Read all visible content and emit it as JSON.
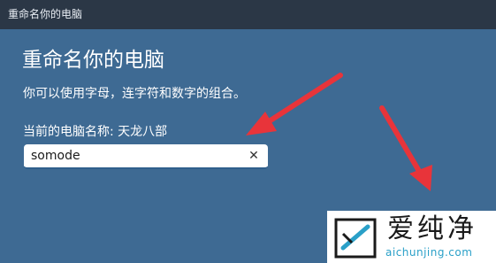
{
  "window": {
    "title": "重命名你的电脑"
  },
  "dialog": {
    "heading": "重命名你的电脑",
    "description": "你可以使用字母，连字符和数字的组合。",
    "current_name_label": "当前的电脑名称: 天龙八部",
    "name_input_value": "somode",
    "clear_icon": "close-icon",
    "clear_glyph": "✕"
  },
  "annotation": {
    "arrow_color": "#e8343a"
  },
  "watermark": {
    "brand": "爱纯净",
    "url": "aichunjing.com"
  }
}
